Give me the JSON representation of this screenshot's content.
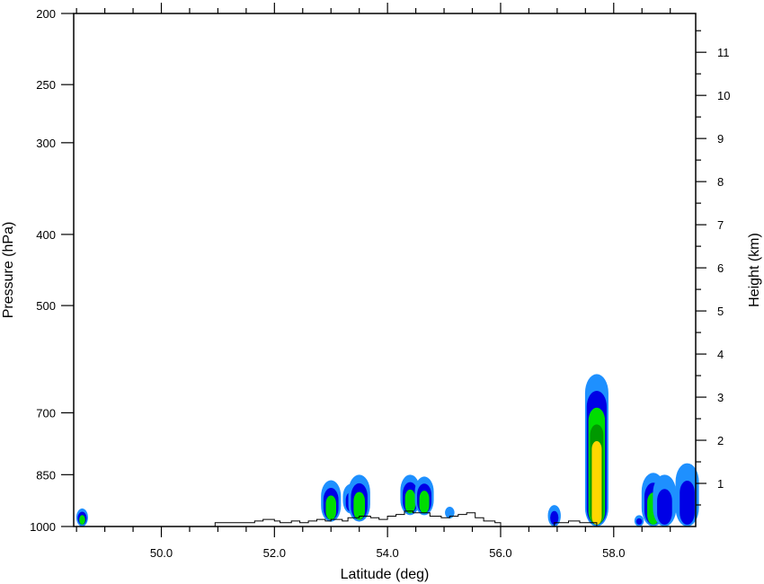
{
  "chart_data": {
    "type": "heatmap",
    "title": "",
    "xlabel": "Latitude (deg)",
    "ylabel": "Pressure (hPa)",
    "y2label": "Height (km)",
    "xlim": [
      48.45,
      59.45
    ],
    "ylim": [
      1000,
      200
    ],
    "y_scale": "log",
    "y2lim": [
      0,
      11.9
    ],
    "x_ticks": [
      50.0,
      52.0,
      54.0,
      56.0,
      58.0
    ],
    "x_tick_labels": [
      "50.0",
      "52.0",
      "54.0",
      "56.0",
      "58.0"
    ],
    "y_ticks": [
      1000,
      850,
      700,
      500,
      400,
      300,
      250,
      200
    ],
    "y_tick_labels": [
      "1000",
      "850",
      "700",
      "500",
      "400",
      "300",
      "250",
      "200"
    ],
    "y2_ticks": [
      1,
      2,
      3,
      4,
      5,
      6,
      7,
      8,
      9,
      10,
      11
    ],
    "y2_tick_labels": [
      "1",
      "2",
      "3",
      "4",
      "5",
      "6",
      "7",
      "8",
      "9",
      "10",
      "11"
    ],
    "grid": false,
    "legend": "none",
    "colors": {
      "level1": "#1e90ff",
      "level2": "#0000e6",
      "level3": "#00dd00",
      "level4": "#009900",
      "level5": "#ffd700",
      "terrain": "#000000",
      "frame": "#000000"
    },
    "contour_cells": [
      {
        "lat": 48.6,
        "p_top": 945,
        "p_bottom": 1000,
        "levels": [
          1,
          2,
          3
        ]
      },
      {
        "lat": 53.0,
        "p_top": 865,
        "p_bottom": 985,
        "levels": [
          1,
          2,
          3
        ]
      },
      {
        "lat": 53.35,
        "p_top": 875,
        "p_bottom": 960,
        "levels": [
          1,
          2
        ]
      },
      {
        "lat": 53.5,
        "p_top": 850,
        "p_bottom": 985,
        "levels": [
          1,
          2,
          3
        ]
      },
      {
        "lat": 54.4,
        "p_top": 850,
        "p_bottom": 965,
        "levels": [
          1,
          2,
          3
        ]
      },
      {
        "lat": 54.65,
        "p_top": 855,
        "p_bottom": 965,
        "levels": [
          1,
          2,
          3
        ]
      },
      {
        "lat": 55.1,
        "p_top": 940,
        "p_bottom": 975,
        "levels": [
          1
        ]
      },
      {
        "lat": 56.95,
        "p_top": 935,
        "p_bottom": 1000,
        "levels": [
          1,
          2
        ]
      },
      {
        "lat": 57.7,
        "p_top": 620,
        "p_bottom": 1000,
        "levels": [
          1,
          2,
          3,
          4,
          5
        ]
      },
      {
        "lat": 58.45,
        "p_top": 965,
        "p_bottom": 1000,
        "levels": [
          1,
          2
        ]
      },
      {
        "lat": 58.7,
        "p_top": 845,
        "p_bottom": 1000,
        "levels": [
          1,
          2,
          3
        ]
      },
      {
        "lat": 58.9,
        "p_top": 850,
        "p_bottom": 1000,
        "levels": [
          1,
          2
        ]
      },
      {
        "lat": 59.3,
        "p_top": 820,
        "p_bottom": 1000,
        "levels": [
          1,
          2
        ]
      }
    ],
    "terrain_pressure": [
      [
        50.95,
        988
      ],
      [
        51.6,
        988
      ],
      [
        51.65,
        983
      ],
      [
        51.8,
        978
      ],
      [
        52.0,
        983
      ],
      [
        52.1,
        988
      ],
      [
        52.3,
        983
      ],
      [
        52.45,
        988
      ],
      [
        52.6,
        983
      ],
      [
        52.75,
        978
      ],
      [
        52.9,
        983
      ],
      [
        53.0,
        978
      ],
      [
        53.2,
        983
      ],
      [
        53.3,
        973
      ],
      [
        53.5,
        968
      ],
      [
        53.7,
        973
      ],
      [
        53.85,
        978
      ],
      [
        54.0,
        968
      ],
      [
        54.15,
        963
      ],
      [
        54.3,
        953
      ],
      [
        54.45,
        958
      ],
      [
        54.6,
        958
      ],
      [
        54.75,
        968
      ],
      [
        54.95,
        973
      ],
      [
        55.1,
        968
      ],
      [
        55.25,
        963
      ],
      [
        55.4,
        958
      ],
      [
        55.55,
        973
      ],
      [
        55.7,
        983
      ],
      [
        55.9,
        988
      ],
      [
        56.0,
        1000
      ],
      [
        56.9,
        1000
      ],
      [
        56.95,
        988
      ],
      [
        57.2,
        983
      ],
      [
        57.4,
        988
      ],
      [
        57.6,
        988
      ],
      [
        57.7,
        1000
      ]
    ]
  }
}
